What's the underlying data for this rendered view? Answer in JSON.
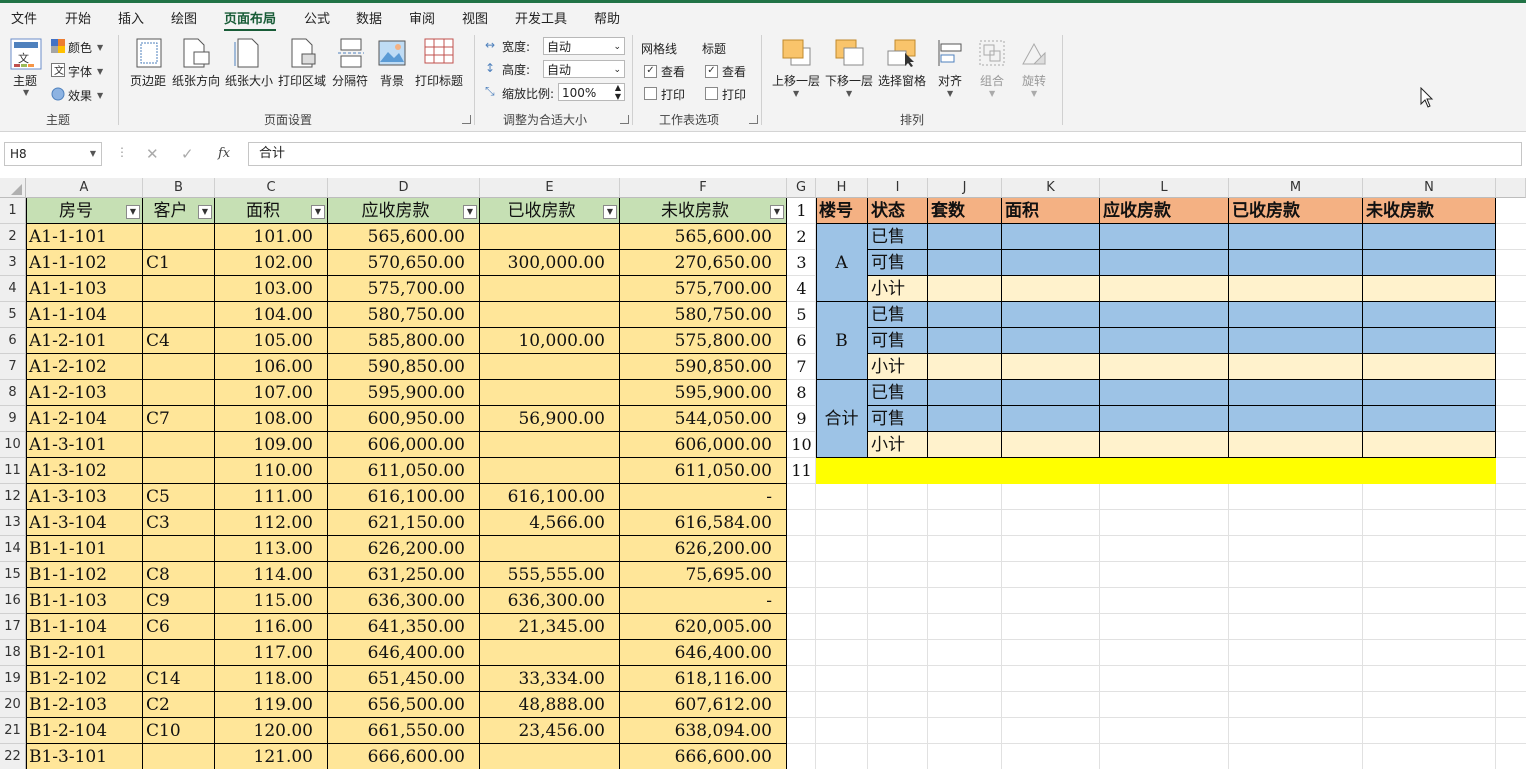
{
  "menu": [
    "文件",
    "开始",
    "插入",
    "绘图",
    "页面布局",
    "公式",
    "数据",
    "审阅",
    "视图",
    "开发工具",
    "帮助"
  ],
  "active_menu": "页面布局",
  "ribbon": {
    "themes_group": {
      "label": "主题",
      "theme_btn": "主题",
      "colors": "颜色",
      "fonts": "字体",
      "effects": "效果"
    },
    "page_setup_group": {
      "label": "页面设置",
      "buttons": [
        "页边距",
        "纸张方向",
        "纸张大小",
        "打印区域",
        "分隔符",
        "背景",
        "打印标题"
      ]
    },
    "scale_group": {
      "label": "调整为合适大小",
      "width_label": "宽度:",
      "width_value": "自动",
      "height_label": "高度:",
      "height_value": "自动",
      "scale_label": "缩放比例:",
      "scale_value": "100%"
    },
    "sheet_options_group": {
      "label": "工作表选项",
      "gridlines": "网格线",
      "headings": "标题",
      "view": "查看",
      "print": "打印",
      "gridlines_view_checked": true,
      "gridlines_print_checked": false,
      "headings_view_checked": true,
      "headings_print_checked": false
    },
    "arrange_group": {
      "label": "排列",
      "buttons": [
        "上移一层",
        "下移一层",
        "选择窗格",
        "对齐",
        "组合",
        "旋转"
      ]
    }
  },
  "formula_bar": {
    "name_box": "H8",
    "fx": "fx",
    "formula": "合计"
  },
  "columns": [
    "A",
    "B",
    "C",
    "D",
    "E",
    "F",
    "G",
    "H",
    "I",
    "J",
    "K",
    "L",
    "M",
    "N"
  ],
  "rows": [
    "1",
    "2",
    "3",
    "4",
    "5",
    "6",
    "7",
    "8",
    "9",
    "10",
    "11",
    "12",
    "13",
    "14",
    "15",
    "16",
    "17",
    "18",
    "19",
    "20",
    "21",
    "22"
  ],
  "left_table": {
    "headers": [
      "房号",
      "客户",
      "面积",
      "应收房款",
      "已收房款",
      "未收房款"
    ],
    "rows": [
      [
        "A1-1-101",
        "",
        "101.00",
        "565,600.00",
        "",
        "565,600.00"
      ],
      [
        "A1-1-102",
        "C1",
        "102.00",
        "570,650.00",
        "300,000.00",
        "270,650.00"
      ],
      [
        "A1-1-103",
        "",
        "103.00",
        "575,700.00",
        "",
        "575,700.00"
      ],
      [
        "A1-1-104",
        "",
        "104.00",
        "580,750.00",
        "",
        "580,750.00"
      ],
      [
        "A1-2-101",
        "C4",
        "105.00",
        "585,800.00",
        "10,000.00",
        "575,800.00"
      ],
      [
        "A1-2-102",
        "",
        "106.00",
        "590,850.00",
        "",
        "590,850.00"
      ],
      [
        "A1-2-103",
        "",
        "107.00",
        "595,900.00",
        "",
        "595,900.00"
      ],
      [
        "A1-2-104",
        "C7",
        "108.00",
        "600,950.00",
        "56,900.00",
        "544,050.00"
      ],
      [
        "A1-3-101",
        "",
        "109.00",
        "606,000.00",
        "",
        "606,000.00"
      ],
      [
        "A1-3-102",
        "",
        "110.00",
        "611,050.00",
        "",
        "611,050.00"
      ],
      [
        "A1-3-103",
        "C5",
        "111.00",
        "616,100.00",
        "616,100.00",
        "-"
      ],
      [
        "A1-3-104",
        "C3",
        "112.00",
        "621,150.00",
        "4,566.00",
        "616,584.00"
      ],
      [
        "B1-1-101",
        "",
        "113.00",
        "626,200.00",
        "",
        "626,200.00"
      ],
      [
        "B1-1-102",
        "C8",
        "114.00",
        "631,250.00",
        "555,555.00",
        "75,695.00"
      ],
      [
        "B1-1-103",
        "C9",
        "115.00",
        "636,300.00",
        "636,300.00",
        "-"
      ],
      [
        "B1-1-104",
        "C6",
        "116.00",
        "641,350.00",
        "21,345.00",
        "620,005.00"
      ],
      [
        "B1-2-101",
        "",
        "117.00",
        "646,400.00",
        "",
        "646,400.00"
      ],
      [
        "B1-2-102",
        "C14",
        "118.00",
        "651,450.00",
        "33,334.00",
        "618,116.00"
      ],
      [
        "B1-2-103",
        "C2",
        "119.00",
        "656,500.00",
        "48,888.00",
        "607,612.00"
      ],
      [
        "B1-2-104",
        "C10",
        "120.00",
        "661,550.00",
        "23,456.00",
        "638,094.00"
      ],
      [
        "B1-3-101",
        "",
        "121.00",
        "666,600.00",
        "",
        "666,600.00"
      ]
    ]
  },
  "right_table": {
    "headers": [
      "楼号",
      "状态",
      "套数",
      "面积",
      "应收房款",
      "已收房款",
      "未收房款"
    ],
    "g_numbers": [
      "1",
      "2",
      "3",
      "4",
      "5",
      "6",
      "7",
      "8",
      "9",
      "10",
      "11"
    ],
    "groups": [
      {
        "name": "A",
        "statuses": [
          "已售",
          "可售",
          "小计"
        ]
      },
      {
        "name": "B",
        "statuses": [
          "已售",
          "可售",
          "小计"
        ]
      },
      {
        "name": "合计",
        "statuses": [
          "已售",
          "可售",
          "小计"
        ]
      }
    ]
  },
  "colors": {
    "left_header": "#c6e0b4",
    "left_body": "#ffe699",
    "right_header": "#f4b183",
    "right_blue": "#9dc3e6",
    "right_subtotal": "#fff2cc",
    "yellow_row": "#ffff00",
    "accent": "#217346"
  }
}
